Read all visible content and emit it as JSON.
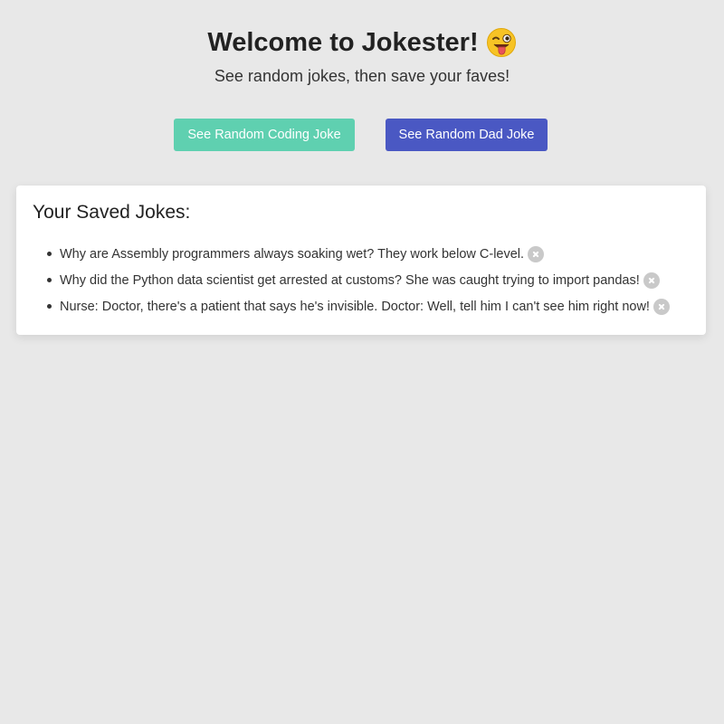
{
  "header": {
    "title": "Welcome to Jokester!",
    "emoji_icon": "winking-face-with-tongue-icon",
    "subtitle": "See random jokes, then save your faves!"
  },
  "buttons": {
    "coding_label": "See Random Coding Joke",
    "dad_label": "See Random Dad Joke",
    "coding_color": "#5fd0b0",
    "dad_color": "#4a58c3"
  },
  "saved": {
    "title": "Your Saved Jokes:",
    "jokes": [
      "Why are Assembly programmers always soaking wet? They work below C-level.",
      "Why did the Python data scientist get arrested at customs? She was caught trying to import pandas!",
      "Nurse: Doctor, there's a patient that says he's invisible. Doctor: Well, tell him I can't see him right now!"
    ],
    "remove_icon": "close-circle-icon"
  }
}
